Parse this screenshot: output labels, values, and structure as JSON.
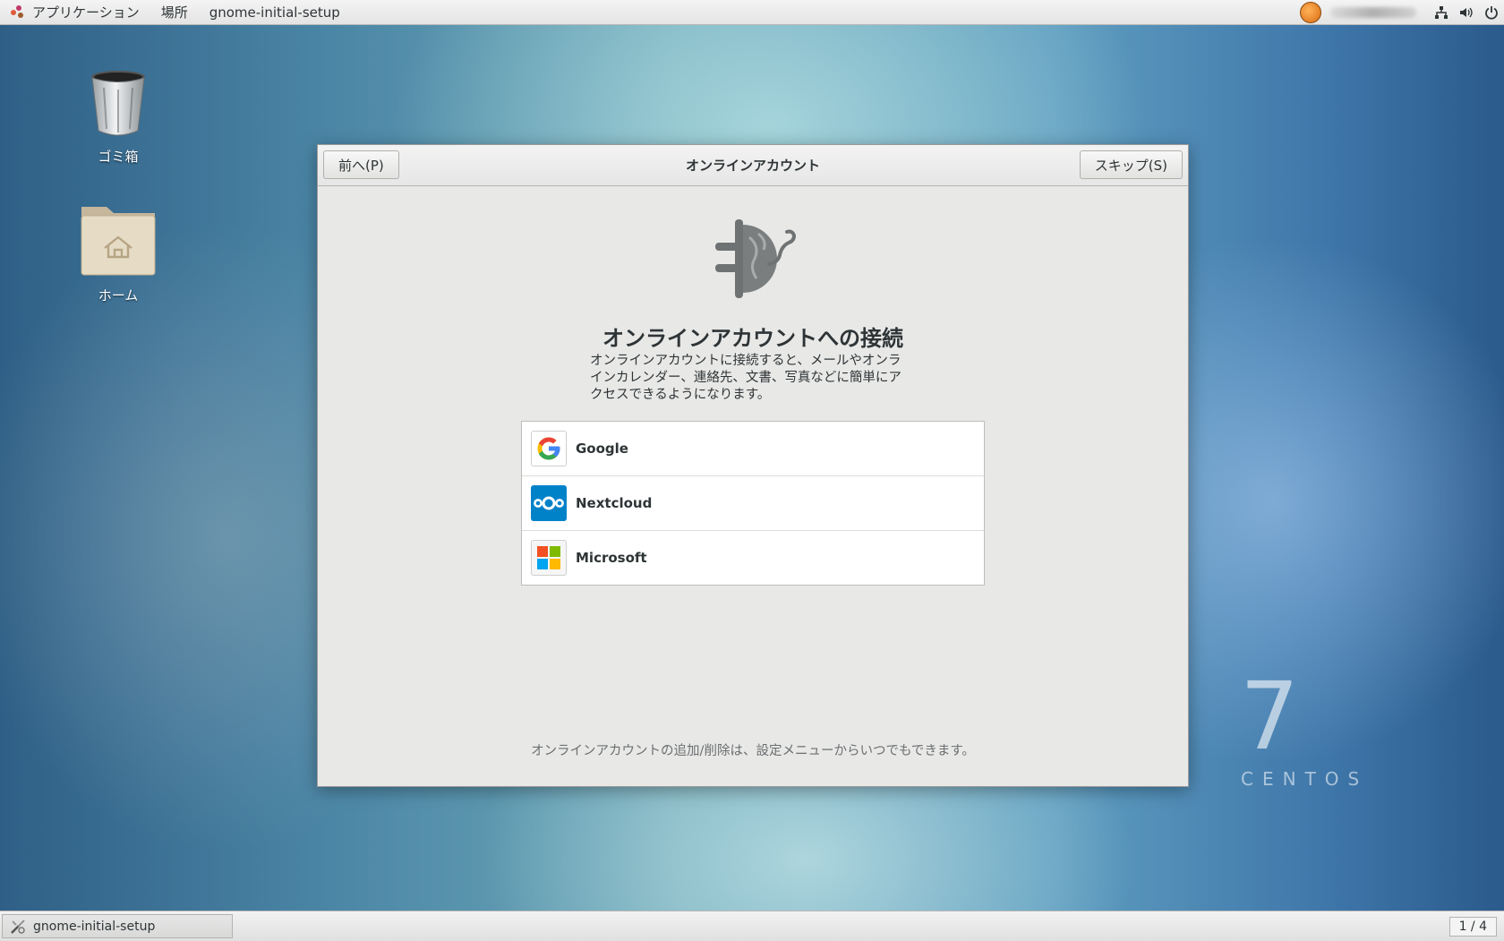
{
  "topbar": {
    "applications": "アプリケーション",
    "places": "場所",
    "app_name": "gnome-initial-setup",
    "tray_icons": [
      "user-avatar-icon",
      "network-icon",
      "volume-icon",
      "power-icon"
    ]
  },
  "desktop": {
    "trash_label": "ゴミ箱",
    "home_label": "ホーム"
  },
  "dialog": {
    "prev_button": "前へ(P)",
    "title": "オンラインアカウント",
    "skip_button": "スキップ(S)",
    "heading": "オンラインアカウントへの接続",
    "description_lines": [
      "オンラインアカウントに接続すると、メールやオンラ",
      "インカレンダー、連絡先、文書、写真などに簡単にア",
      "クセスできるようになります。"
    ],
    "accounts": [
      {
        "label": "Google",
        "icon": "google-icon"
      },
      {
        "label": "Nextcloud",
        "icon": "nextcloud-icon"
      },
      {
        "label": "Microsoft",
        "icon": "microsoft-icon"
      }
    ],
    "footnote": "オンラインアカウントの追加/削除は、設定メニューからいつでもできます。"
  },
  "watermark": {
    "version": "7",
    "brand": "CENTOS"
  },
  "taskbar": {
    "window_label": "gnome-initial-setup",
    "workspace": "1 / 4"
  },
  "colors": {
    "google_blue": "#4285F4",
    "google_red": "#EA4335",
    "google_yellow": "#FBBC05",
    "google_green": "#34A853",
    "nextcloud_blue": "#0082C9",
    "ms_red": "#F25022",
    "ms_green": "#7FBA00",
    "ms_blue": "#00A4EF",
    "ms_yellow": "#FFB900"
  }
}
